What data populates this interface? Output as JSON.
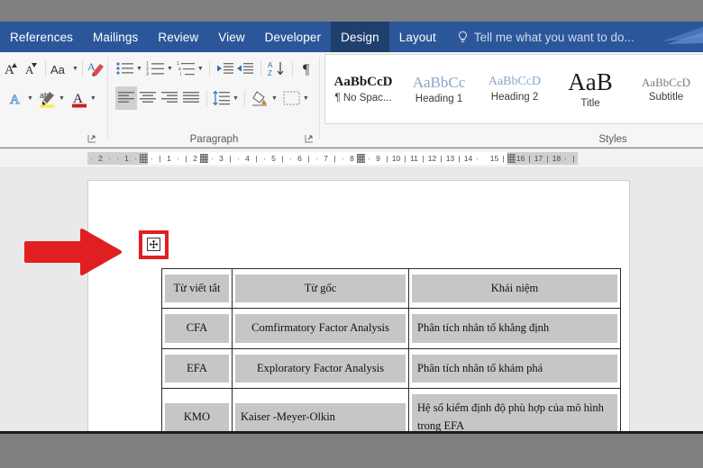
{
  "window": {
    "app": "Microsoft Word",
    "chrome_color": "#2b579a",
    "active_tab_color": "#1f3f6e"
  },
  "ribbon_tabs": {
    "items": [
      {
        "label": "References",
        "active": false
      },
      {
        "label": "Mailings",
        "active": false
      },
      {
        "label": "Review",
        "active": false
      },
      {
        "label": "View",
        "active": false
      },
      {
        "label": "Developer",
        "active": false
      },
      {
        "label": "Design",
        "active": true
      },
      {
        "label": "Layout",
        "active": false
      }
    ],
    "tell_me": {
      "placeholder": "Tell me what you want to do...",
      "icon": "lightbulb-icon"
    }
  },
  "ribbon_groups": [
    {
      "name": "font",
      "label": "",
      "row1": [
        {
          "icon": "grow-font-icon",
          "label": "A"
        },
        {
          "icon": "shrink-font-icon",
          "label": "A"
        },
        {
          "icon": "change-case-icon",
          "label": "Aa"
        },
        {
          "icon": "clear-formatting-icon",
          "label": "A"
        }
      ],
      "row2": [
        {
          "icon": "text-effects-icon",
          "label": "A"
        },
        {
          "icon": "text-highlight-color-icon",
          "label": "ab"
        },
        {
          "icon": "font-color-icon",
          "label": "A"
        }
      ]
    },
    {
      "name": "paragraph",
      "label": "Paragraph",
      "row1": [
        {
          "icon": "bullets-icon"
        },
        {
          "icon": "numbering-icon"
        },
        {
          "icon": "multilevel-list-icon"
        },
        {
          "icon": "decrease-indent-icon"
        },
        {
          "icon": "increase-indent-icon"
        },
        {
          "icon": "sort-icon"
        },
        {
          "icon": "show-formatting-marks-icon"
        }
      ],
      "row2": [
        {
          "icon": "align-left-icon",
          "pressed": true
        },
        {
          "icon": "align-center-icon"
        },
        {
          "icon": "align-right-icon"
        },
        {
          "icon": "justify-icon"
        },
        {
          "icon": "line-spacing-icon"
        },
        {
          "icon": "shading-icon"
        },
        {
          "icon": "borders-icon"
        }
      ]
    },
    {
      "name": "styles",
      "label": "Styles"
    }
  ],
  "styles_gallery": {
    "items": [
      {
        "preview": "AaBbCcD",
        "name": "¶ No Spac...",
        "preview_size": 15,
        "preview_color": "#1a1a1a",
        "bold": true
      },
      {
        "preview": "AaBbCc",
        "name": "Heading 1",
        "preview_size": 17,
        "preview_color": "#8aa7c8",
        "bold": false
      },
      {
        "preview": "AaBbCcD",
        "name": "Heading 2",
        "preview_size": 14,
        "preview_color": "#8aa7c8",
        "bold": false
      },
      {
        "preview": "AaB",
        "name": "Title",
        "preview_size": 26,
        "preview_color": "#1a1a1a",
        "bold": false
      },
      {
        "preview": "AaBbCcD",
        "name": "Subtitle",
        "preview_size": 13,
        "preview_color": "#7b7b7b",
        "bold": false
      }
    ]
  },
  "ruler": {
    "left_margin_ticks": [
      "·",
      "2",
      "·",
      "·",
      "1",
      "·"
    ],
    "numbers": [
      "1",
      "2",
      "3",
      "4",
      "5",
      "6",
      "7",
      "8",
      "9",
      "10",
      "11",
      "12",
      "13",
      "14",
      "15",
      "16",
      "17",
      "18"
    ],
    "indent_marker": "indent-marker"
  },
  "document": {
    "table_move_handle": {
      "icon": "table-move-handle-icon",
      "highlighted": true,
      "highlight_color": "#e02020"
    },
    "annotation_arrow": {
      "icon": "red-arrow-right-icon",
      "color": "#e02020",
      "points_to": "table-move-handle"
    },
    "table": {
      "headers": [
        "Từ viết tắt",
        "Từ gốc",
        "Khái niệm"
      ],
      "rows": [
        {
          "abbr": "CFA",
          "original": "Comfirmatory Factor Analysis",
          "meaning": "Phân tích nhân tố khẳng định"
        },
        {
          "abbr": "EFA",
          "original": "Exploratory Factor Analysis",
          "meaning": "Phân tích nhân tố khám phá"
        },
        {
          "abbr": "KMO",
          "original": "Kaiser -Meyer-Olkin",
          "meaning": "Hệ số kiểm định độ phù hợp của mô hình trong EFA"
        }
      ],
      "selection_color": "#c6c6c6"
    }
  }
}
